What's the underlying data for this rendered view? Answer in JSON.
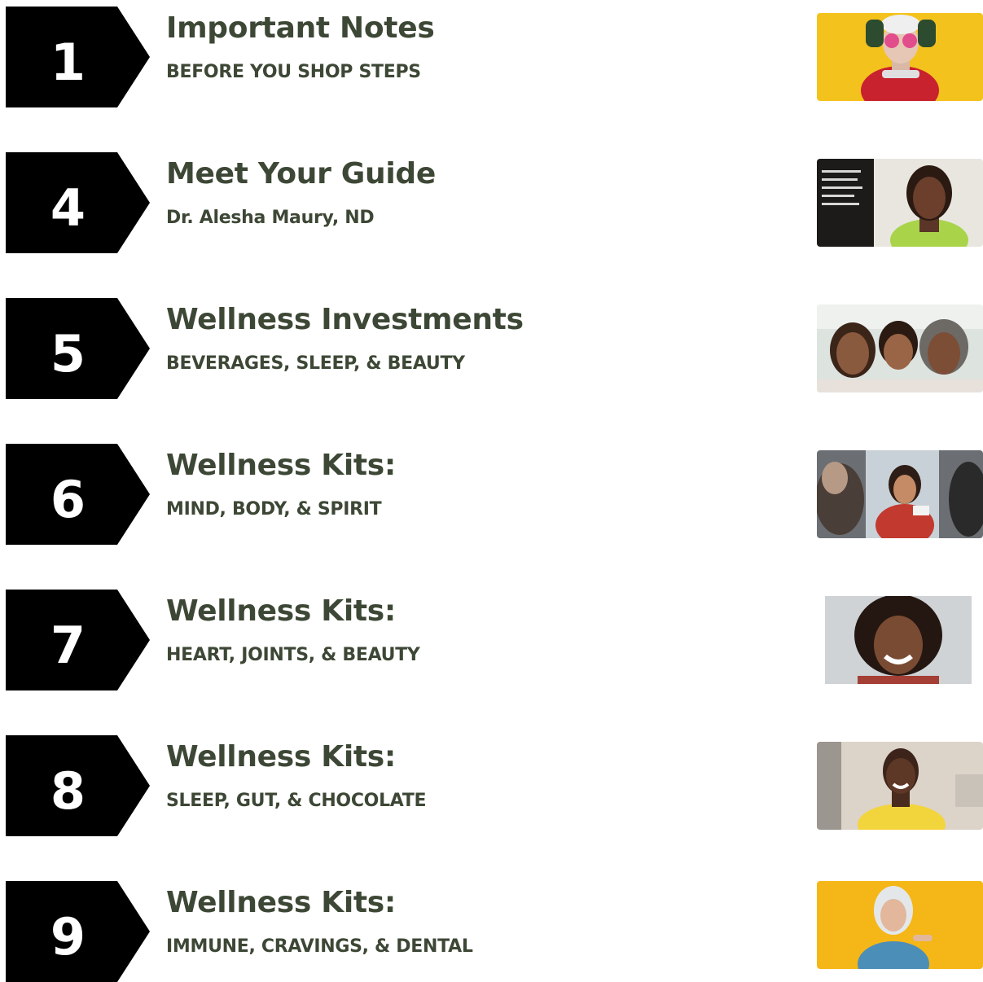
{
  "toc": [
    {
      "page": "1",
      "title": "Important Notes",
      "subtitle": "BEFORE YOU SHOP STEPS",
      "photo": "woman-in-sunglasses-yellow-photo"
    },
    {
      "page": "4",
      "title": "Meet Your Guide",
      "subtitle": "Dr. Alesha Maury, ND",
      "photo": "guide-portrait-photo"
    },
    {
      "page": "5",
      "title": "Wellness Investments",
      "subtitle": "BEVERAGES, SLEEP, & BEAUTY",
      "photo": "three-generations-photo"
    },
    {
      "page": "6",
      "title": "Wellness Kits:",
      "subtitle": "MIND, BODY, & SPIRIT",
      "photo": "group-conversation-photo"
    },
    {
      "page": "7",
      "title": "Wellness Kits:",
      "subtitle": "HEART, JOINTS, & BEAUTY",
      "photo": "smiling-woman-curly-hair-photo"
    },
    {
      "page": "8",
      "title": "Wellness Kits:",
      "subtitle": "SLEEP, GUT, & CHOCOLATE",
      "photo": "smiling-woman-yellow-top-photo"
    },
    {
      "page": "9",
      "title": "Wellness Kits:",
      "subtitle": "IMMUNE, CRAVINGS, & DENTAL",
      "photo": "woman-pointing-yellow-photo"
    }
  ],
  "colors": {
    "badge": "#000000",
    "badge_text": "#ffffff",
    "heading_text": "#3d4735"
  }
}
